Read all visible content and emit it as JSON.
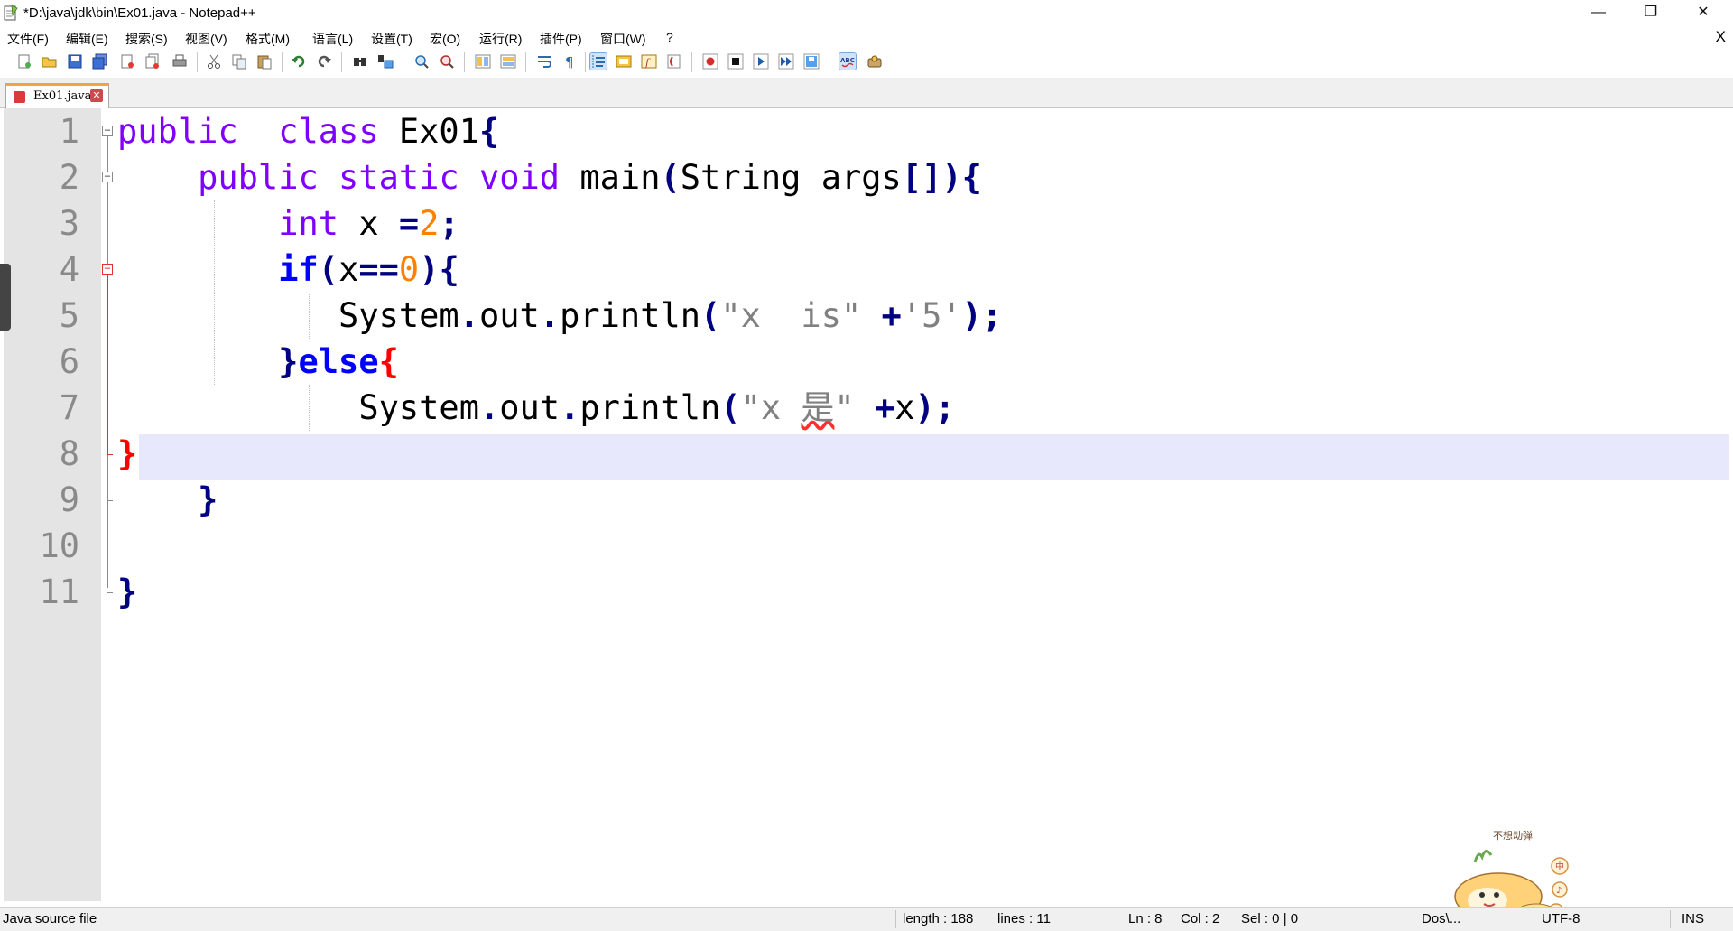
{
  "window": {
    "title": "*D:\\java\\jdk\\bin\\Ex01.java - Notepad++",
    "minimize": "—",
    "maximize": "❐",
    "close": "✕"
  },
  "menu": {
    "items": [
      "文件(F)",
      "编辑(E)",
      "搜索(S)",
      "视图(V)",
      "格式(M)",
      "语言(L)",
      "设置(T)",
      "宏(O)",
      "运行(R)",
      "插件(P)",
      "窗口(W)",
      "?"
    ],
    "close_doc": "X"
  },
  "tab": {
    "label": "Ex01.java",
    "close": "✕"
  },
  "editor": {
    "line_numbers": [
      "1",
      "2",
      "3",
      "4",
      "5",
      "6",
      "7",
      "8",
      "9",
      "10",
      "11"
    ],
    "current_line": 8
  },
  "code": {
    "l1": {
      "a": "public",
      "b": "  ",
      "c": "class",
      "d": " Ex01",
      "e": "{"
    },
    "l2": {
      "indent": "    ",
      "a": "public",
      "b": " ",
      "c": "static",
      "d": " ",
      "e": "void",
      "f": " main",
      "g": "(",
      "h": "String",
      "i": " args",
      "j": "[])",
      "k": "{"
    },
    "l3": {
      "indent": "        ",
      "a": "int",
      "b": " x ",
      "c": "=",
      "d": "2",
      "e": ";"
    },
    "l4": {
      "indent": "        ",
      "a": "if",
      "b": "(",
      "c": "x",
      "d": "==",
      "e": "0",
      "f": ")",
      "g": "{"
    },
    "l5": {
      "indent": "           ",
      "a": "System",
      "b": ".",
      "c": "out",
      "d": ".",
      "e": "println",
      "f": "(",
      "g": "\"x  is\"",
      "h": " ",
      "i": "+",
      "j": "'5'",
      "k": ");"
    },
    "l6": {
      "indent": "        ",
      "a": "}",
      "b": "else",
      "c": "{"
    },
    "l7": {
      "indent": "            ",
      "a": "System",
      "b": ".",
      "c": "out",
      "d": ".",
      "e": "println",
      "f": "(",
      "g": "\"x ",
      "h": "是",
      "i": "\"",
      "j": " ",
      "k": "+",
      "l": "x",
      "m": ");"
    },
    "l8": {
      "a": "}"
    },
    "l9": {
      "indent": "    ",
      "a": "}"
    },
    "l11": {
      "a": "}"
    }
  },
  "status": {
    "file_type": "Java source file",
    "length": "length : 188",
    "lines": "lines : 11",
    "ln": "Ln : 8",
    "col": "Col : 2",
    "sel": "Sel : 0 | 0",
    "eol": "Dos\\...",
    "encoding": "UTF-8",
    "mode": "INS"
  },
  "mascot": {
    "text": "不想动弹",
    "badges": [
      "中",
      "♪",
      "✿"
    ]
  },
  "toolbar_icons": [
    "new-file-icon",
    "open-file-icon",
    "save-icon",
    "save-all-icon",
    "close-icon",
    "close-all-icon",
    "print-icon",
    "cut-icon",
    "copy-icon",
    "paste-icon",
    "undo-icon",
    "redo-icon",
    "find-icon",
    "replace-icon",
    "zoom-in-icon",
    "zoom-out-icon",
    "sync-vertical-icon",
    "sync-horizontal-icon",
    "word-wrap-icon",
    "show-all-chars-icon",
    "indent-guide-icon",
    "doc-map-icon",
    "function-list-icon",
    "folder-workspace-icon",
    "record-macro-icon",
    "stop-macro-icon",
    "play-macro-icon",
    "run-macro-multiple-icon",
    "save-macro-icon",
    "spell-check-icon",
    "plugin-icon"
  ],
  "colors": {
    "keyword": "#8000ff",
    "keyword_bold": "#0000ff",
    "operator": "#000080",
    "number": "#ff8000",
    "string": "#808080",
    "current_line": "#e8e8fd",
    "tab_accent": "#f9a03f"
  }
}
